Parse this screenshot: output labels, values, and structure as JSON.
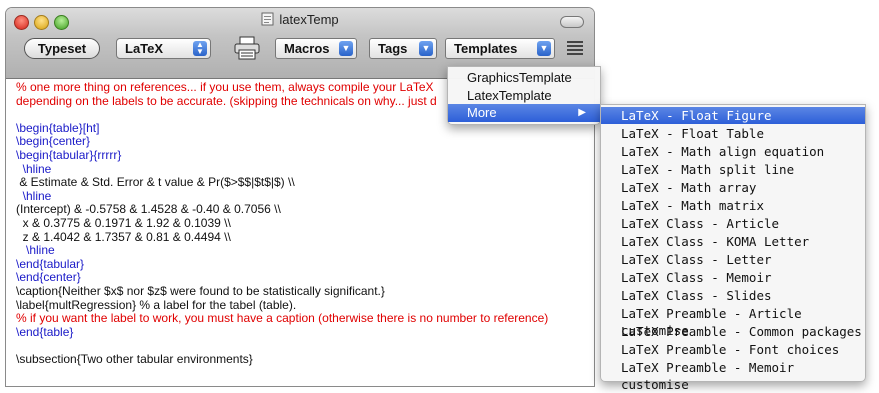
{
  "window": {
    "title": "latexTemp"
  },
  "toolbar": {
    "typeset_label": "Typeset",
    "engine_value": "LaTeX",
    "macros_label": "Macros",
    "tags_label": "Tags",
    "templates_label": "Templates"
  },
  "editor": {
    "lines": [
      {
        "text": "% one more thing on references... if you use them, always compile your LaTeX",
        "color": "red"
      },
      {
        "text": "depending on the labels to be accurate. (skipping the technicals on why... just d",
        "color": "red"
      },
      {
        "text": "",
        "color": "black"
      },
      {
        "text": "\\begin{table}[ht]",
        "color": "blue"
      },
      {
        "text": "\\begin{center}",
        "color": "blue"
      },
      {
        "text": "\\begin{tabular}{rrrrr}",
        "color": "blue"
      },
      {
        "text": "  \\hline",
        "color": "blue"
      },
      {
        "text": " & Estimate & Std. Error & t value & Pr($>$$|$t$|$) \\\\",
        "color": "black"
      },
      {
        "text": "  \\hline",
        "color": "blue"
      },
      {
        "text": "(Intercept) & -0.5758 & 1.4528 & -0.40 & 0.7056 \\\\",
        "color": "black"
      },
      {
        "text": "  x & 0.3775 & 0.1971 & 1.92 & 0.1039 \\\\",
        "color": "black"
      },
      {
        "text": "  z & 1.4042 & 1.7357 & 0.81 & 0.4494 \\\\",
        "color": "black"
      },
      {
        "text": "   \\hline",
        "color": "blue"
      },
      {
        "text": "\\end{tabular}",
        "color": "blue"
      },
      {
        "text": "\\end{center}",
        "color": "blue"
      },
      {
        "text": "\\caption{Neither $x$ nor $z$ were found to be statistically significant.}",
        "color": "black"
      },
      {
        "text": "\\label{multRegression} % a label for the tabel (table).",
        "color": "black"
      },
      {
        "text": "% if you want the label to work, you must have a caption (otherwise there is no number to reference)",
        "color": "red"
      },
      {
        "text": "\\end{table}",
        "color": "blue"
      },
      {
        "text": "",
        "color": "black"
      },
      {
        "text": "\\subsection{Two other tabular environments}",
        "color": "black"
      }
    ]
  },
  "templates_menu": {
    "items": [
      {
        "label": "GraphicsTemplate"
      },
      {
        "label": "LatexTemplate"
      },
      {
        "label": "More",
        "submenu_arrow": "▶",
        "selected": true
      }
    ]
  },
  "more_menu": {
    "items": [
      {
        "label": "LaTeX - Float Figure",
        "selected": true
      },
      {
        "label": "LaTeX - Float Table"
      },
      {
        "label": "LaTeX - Math  align equation"
      },
      {
        "label": "LaTeX - Math  split line"
      },
      {
        "label": "LaTeX - Math array"
      },
      {
        "label": "LaTeX - Math matrix"
      },
      {
        "label": "LaTeX Class - Article"
      },
      {
        "label": "LaTeX Class - KOMA Letter"
      },
      {
        "label": "LaTeX Class - Letter"
      },
      {
        "label": "LaTeX Class - Memoir"
      },
      {
        "label": "LaTeX Class - Slides"
      },
      {
        "label": "LaTeX Preamble - Article customise"
      },
      {
        "label": "LaTeX Preamble - Common packages"
      },
      {
        "label": "LaTeX Preamble - Font choices"
      },
      {
        "label": "LaTeX Preamble - Memoir customise"
      }
    ]
  },
  "colors": {
    "comment": "#e00000",
    "command": "#1a1ac8",
    "selection": "#2d5fd8"
  }
}
